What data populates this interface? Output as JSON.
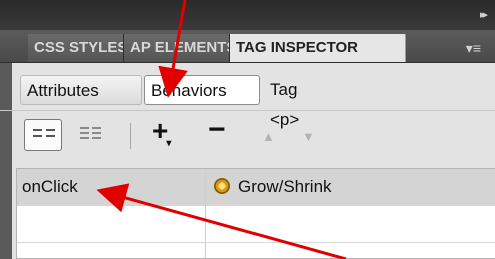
{
  "panel_header": {
    "collapse_glyph": "▸▸"
  },
  "tabs": [
    {
      "label": "CSS STYLES"
    },
    {
      "label": "AP ELEMENTS"
    },
    {
      "label": "TAG INSPECTOR",
      "active": true
    }
  ],
  "tab_menu_glyph": "▾≡",
  "subtabs": {
    "attributes": "Attributes",
    "behaviors": "Behaviors",
    "tag_label": "Tag <p>"
  },
  "toolbar": {
    "show_set_events": "show-set-events-icon",
    "show_all_events": "show-all-events-icon",
    "add_glyph": "+",
    "add_caret": "▾",
    "remove_glyph": "−",
    "up_glyph": "▲",
    "down_glyph": "▼"
  },
  "behaviors_table": {
    "rows": [
      {
        "event": "onClick",
        "action": "Grow/Shrink",
        "icon": "behavior-gear-icon",
        "selected": true
      },
      {
        "event": "",
        "action": "",
        "selected": false
      }
    ]
  },
  "annotation_color": "#e00000"
}
